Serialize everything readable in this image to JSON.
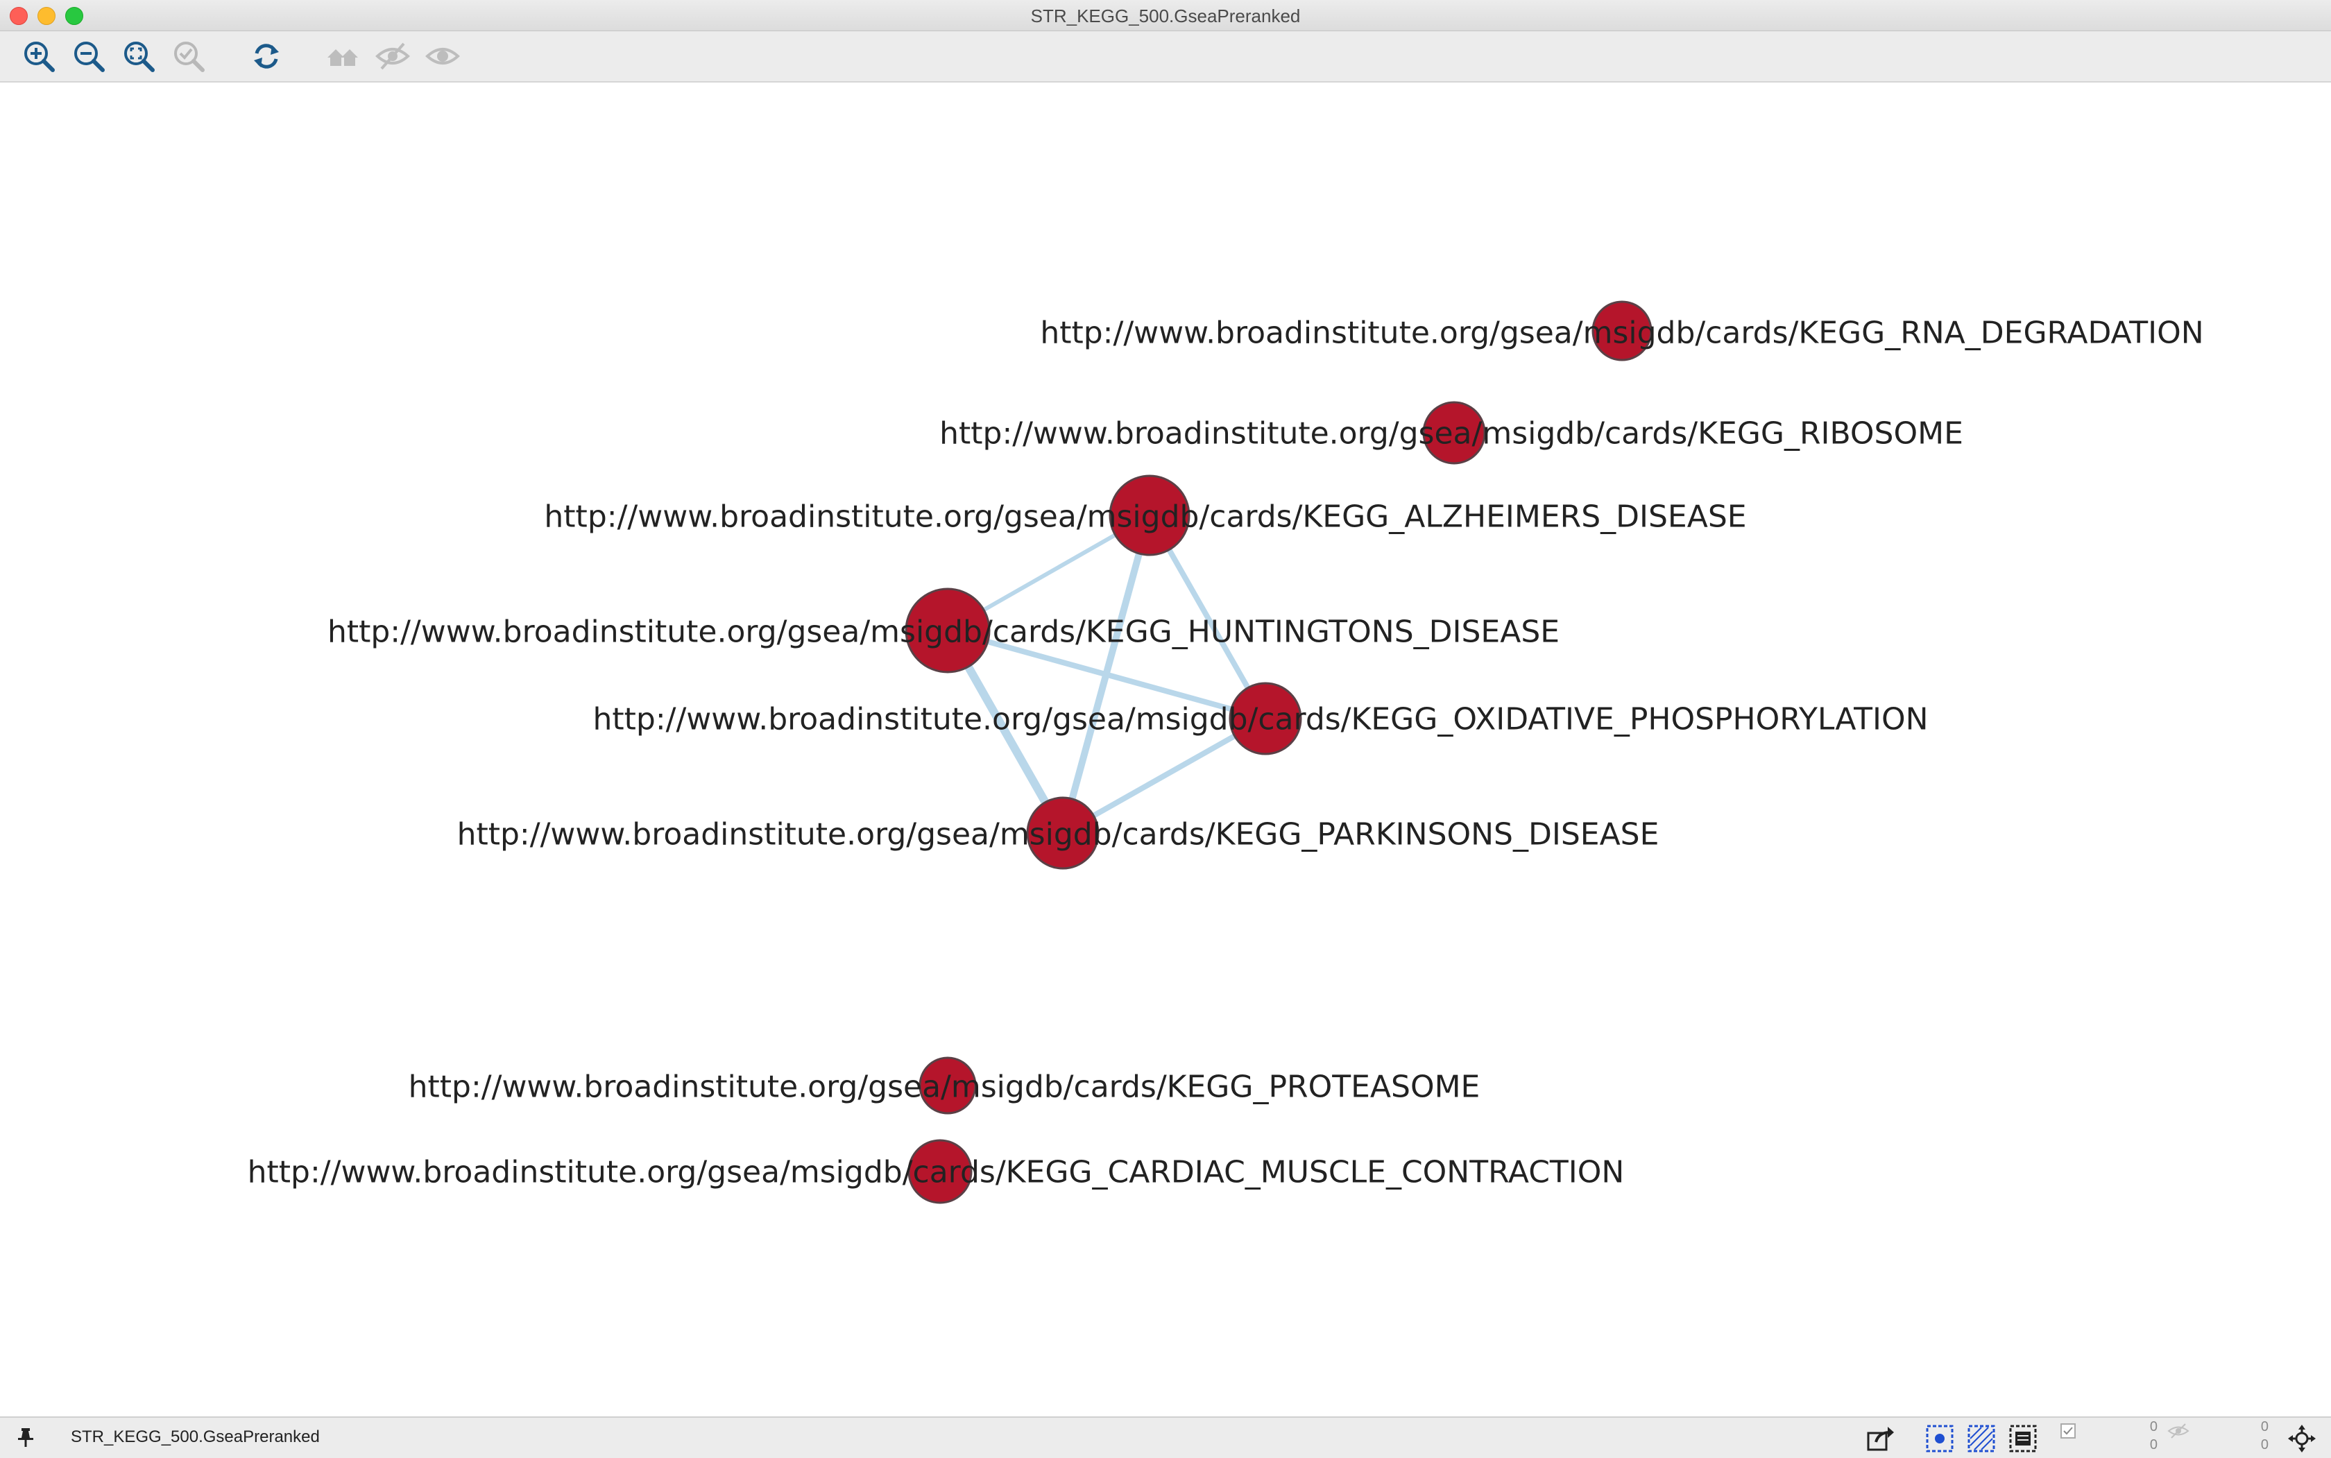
{
  "window": {
    "title": "STR_KEGG_500.GseaPreranked"
  },
  "toolbar": {
    "buttons": [
      {
        "name": "zoom-in-icon"
      },
      {
        "name": "zoom-out-icon"
      },
      {
        "name": "zoom-fit-icon"
      },
      {
        "name": "zoom-selected-icon"
      },
      {
        "name": "refresh-icon"
      },
      {
        "name": "show-all-icon"
      },
      {
        "name": "hide-icon"
      },
      {
        "name": "show-icon"
      }
    ]
  },
  "network": {
    "node_color": "#b5152b",
    "edge_color": "#b9d7ea",
    "nodes": [
      {
        "id": "rna_degradation",
        "label": "http://www.broadinstitute.org/gsea/msigdb/cards/KEGG_RNA_DEGRADATION"
      },
      {
        "id": "ribosome",
        "label": "http://www.broadinstitute.org/gsea/msigdb/cards/KEGG_RIBOSOME"
      },
      {
        "id": "alzheimers",
        "label": "http://www.broadinstitute.org/gsea/msigdb/cards/KEGG_ALZHEIMERS_DISEASE"
      },
      {
        "id": "huntingtons",
        "label": "http://www.broadinstitute.org/gsea/msigdb/cards/KEGG_HUNTINGTONS_DISEASE"
      },
      {
        "id": "oxphos",
        "label": "http://www.broadinstitute.org/gsea/msigdb/cards/KEGG_OXIDATIVE_PHOSPHORYLATION"
      },
      {
        "id": "parkinsons",
        "label": "http://www.broadinstitute.org/gsea/msigdb/cards/KEGG_PARKINSONS_DISEASE"
      },
      {
        "id": "proteasome",
        "label": "http://www.broadinstitute.org/gsea/msigdb/cards/KEGG_PROTEASOME"
      },
      {
        "id": "cardiac",
        "label": "http://www.broadinstitute.org/gsea/msigdb/cards/KEGG_CARDIAC_MUSCLE_CONTRACTION"
      }
    ],
    "edges": [
      {
        "source": "alzheimers",
        "target": "huntingtons"
      },
      {
        "source": "alzheimers",
        "target": "oxphos"
      },
      {
        "source": "alzheimers",
        "target": "parkinsons"
      },
      {
        "source": "huntingtons",
        "target": "oxphos"
      },
      {
        "source": "huntingtons",
        "target": "parkinsons"
      },
      {
        "source": "oxphos",
        "target": "parkinsons"
      }
    ]
  },
  "statusbar": {
    "network_name": "STR_KEGG_500.GseaPreranked",
    "counts": [
      "0",
      "0",
      "0",
      "0"
    ]
  }
}
